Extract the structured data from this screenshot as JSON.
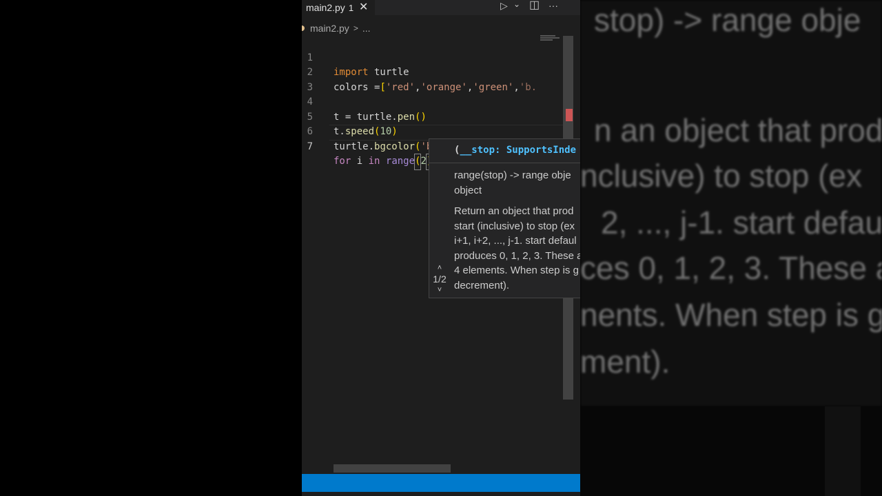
{
  "tab": {
    "label": "main2.py",
    "problems": "1",
    "close": "✕"
  },
  "toolbar": {
    "run": "▷",
    "run_dropdown": "⌄",
    "split": "◫",
    "more": "···"
  },
  "breadcrumb": {
    "file": "main2.py",
    "separator": ">",
    "ellipsis": "..."
  },
  "code": {
    "line_numbers": [
      "1",
      "2",
      "3",
      "4",
      "5",
      "6",
      "7"
    ],
    "l1": {
      "kw": "import",
      "rest": " turtle"
    },
    "l2": {
      "a": "colors =",
      "b": "[",
      "s1": "'red'",
      "c1": ",",
      "s2": "'orange'",
      "c2": ",",
      "s3": "'green'",
      "c3": ",",
      "s4": "'b."
    },
    "l4": {
      "a": "t = turtle.",
      "fn": "pen",
      "b": "()"
    },
    "l5": {
      "a": "t.",
      "fn": "speed",
      "b1": "(",
      "num": "10",
      "b2": ")"
    },
    "l6": {
      "a": "turtle.",
      "fn": "bgcolor",
      "b1": "(",
      "s": "'black'",
      "b2": ")"
    },
    "l7": {
      "kw1": "for",
      "a": " i ",
      "kw2": "in",
      "sp": " ",
      "fn": "range",
      "b1": "(",
      "num": "2",
      "b2": ")"
    }
  },
  "hover": {
    "sig_open": "(",
    "param": "__stop: SupportsInde",
    "doc1_line1": "range(stop) -> range obje",
    "doc1_line2": "object",
    "doc2_lines": [
      "Return an object that prod",
      "start (inclusive) to stop (ex",
      "i+1, i+2, ..., j-1. start defaul",
      "produces 0, 1, 2, 3. These a",
      "4 elements. When step is g",
      "decrement)."
    ],
    "pager_up": "˄",
    "pager_count": "1/2",
    "pager_down": "˅"
  },
  "background_zoom": [
    "stop) -> range obje",
    "n an object that prod",
    "nclusive) to stop (ex",
    "2, ..., j-1. start defau",
    "ces 0, 1, 2, 3. These a",
    "nents. When step is g",
    "ment)."
  ],
  "colors": {
    "editor_bg": "#1e1e1e",
    "statusbar": "#007acc",
    "keyword": "#c586c0",
    "string": "#ce9178",
    "function": "#dcdcaa",
    "param": "#4fc1ff"
  }
}
